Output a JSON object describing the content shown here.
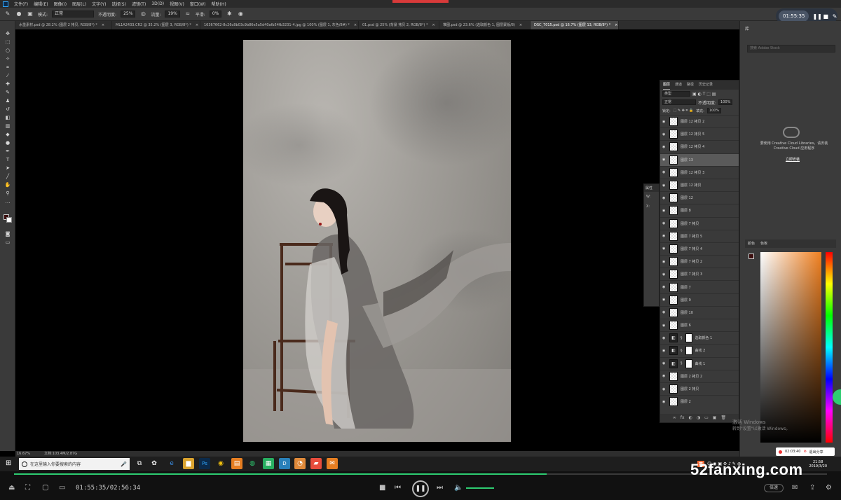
{
  "app": {
    "menu": [
      "文件(F)",
      "编辑(E)",
      "图像(I)",
      "图层(L)",
      "文字(Y)",
      "选择(S)",
      "滤镜(T)",
      "3D(D)",
      "视图(V)",
      "窗口(W)",
      "帮助(H)"
    ]
  },
  "options": {
    "mode_label": "模式:",
    "mode_value": "正常",
    "opacity_label": "不透明度:",
    "opacity_value": "25%",
    "flow_label": "流量:",
    "flow_value": "19%",
    "smooth_label": "平滑:",
    "smooth_value": "0%"
  },
  "recorder": {
    "time": "01:55:35"
  },
  "tabs": [
    {
      "label": "水墨素材.psd @ 28.2% (图层 2 拷贝, RGB/8*) *",
      "close": "×"
    },
    {
      "label": "ML1A2433.CR2 @ 35.2% (图层 3, RGB/8*) *",
      "close": "×"
    },
    {
      "label": "16367662-8c26c8b03c9b86e5a5d40afb54fb3231-4.jpg @ 100% (图层 1, 灰色/8#) *",
      "close": "×"
    },
    {
      "label": "01.psd @ 25% (背景 拷贝 2, RGB/8*) *",
      "close": "×"
    },
    {
      "label": "堆图.psd @ 23.6% (选取颜色 1, 图层蒙版/8)",
      "close": "×"
    },
    {
      "label": "DSC_7015.psd @ 16.7% (图层 13, RGB/8*) *",
      "close": "×"
    }
  ],
  "status": {
    "zoom": "16.67%",
    "doc": "文档:103.4M/2.87G"
  },
  "library": {
    "header": "库",
    "search_placeholder": "搜索 Adobe Stock",
    "cc_text": "要使用 Creative Cloud Libraries，请安装 Creative Cloud 应用程序",
    "cc_button": "立即安装"
  },
  "color_panel": {
    "tabs": [
      "颜色",
      "色板"
    ]
  },
  "layers_panel": {
    "tabs": [
      "图层",
      "通道",
      "路径",
      "历史记录"
    ],
    "kind": "类型",
    "blend": "正常",
    "opacity_label": "不透明度:",
    "opacity": "100%",
    "lock_label": "锁定:",
    "fill_label": "填充:",
    "fill": "100%",
    "layers": [
      {
        "name": "图层 12 拷贝 2",
        "type": "pixel",
        "selected": false
      },
      {
        "name": "图层 12 拷贝 5",
        "type": "pixel",
        "selected": false
      },
      {
        "name": "图层 12 拷贝 4",
        "type": "pixel",
        "selected": false
      },
      {
        "name": "图层 13",
        "type": "pixel",
        "selected": true
      },
      {
        "name": "图层 12 拷贝 3",
        "type": "pixel",
        "selected": false
      },
      {
        "name": "图层 12 拷贝",
        "type": "pixel",
        "selected": false
      },
      {
        "name": "图层 12",
        "type": "pixel",
        "selected": false
      },
      {
        "name": "图层 8",
        "type": "pixel",
        "selected": false
      },
      {
        "name": "图层 7 拷贝",
        "type": "pixel",
        "selected": false
      },
      {
        "name": "图层 7 拷贝 5",
        "type": "pixel",
        "selected": false
      },
      {
        "name": "图层 7 拷贝 4",
        "type": "pixel",
        "selected": false
      },
      {
        "name": "图层 7 拷贝 2",
        "type": "pixel",
        "selected": false
      },
      {
        "name": "图层 7 拷贝 3",
        "type": "pixel",
        "selected": false
      },
      {
        "name": "图层 7",
        "type": "pixel",
        "selected": false
      },
      {
        "name": "图层 9",
        "type": "pixel",
        "selected": false
      },
      {
        "name": "图层 10",
        "type": "pixel",
        "selected": false
      },
      {
        "name": "图层 6",
        "type": "pixel",
        "selected": false
      },
      {
        "name": "选取颜色 1",
        "type": "adjustment",
        "selected": false
      },
      {
        "name": "曲线 2",
        "type": "adjustment",
        "selected": false
      },
      {
        "name": "曲线 1",
        "type": "adjustment",
        "selected": false
      },
      {
        "name": "图层 2 拷贝 2",
        "type": "pixel",
        "selected": false
      },
      {
        "name": "图层 2 拷贝",
        "type": "pixel",
        "selected": false
      },
      {
        "name": "图层 2",
        "type": "pixel",
        "selected": false
      }
    ],
    "footer_icons": [
      "∞",
      "fx",
      "◐",
      "◑",
      "▭",
      "▣",
      "🗑"
    ]
  },
  "props_panel": {
    "title": "属性",
    "w": "W:",
    "x": "X:"
  },
  "activate": {
    "line1": "激活 Windows",
    "line2": "转到\"设置\"以激活 Windows。"
  },
  "share": {
    "time": "02:03:40",
    "exit": "退出分享"
  },
  "taskbar": {
    "search_placeholder": "在这里输入你要搜索的内容",
    "ime": "英",
    "time": "21:58",
    "date": "2019/3/20"
  },
  "player": {
    "time": "01:55:35/02:56:34",
    "speed": "倍速",
    "progress": 0.655
  },
  "watermark": "52fanxing.com",
  "colors": {
    "accent_green": "#2ecc71",
    "ps_blue": "#31a8ff",
    "rec_red": "#e33333"
  }
}
